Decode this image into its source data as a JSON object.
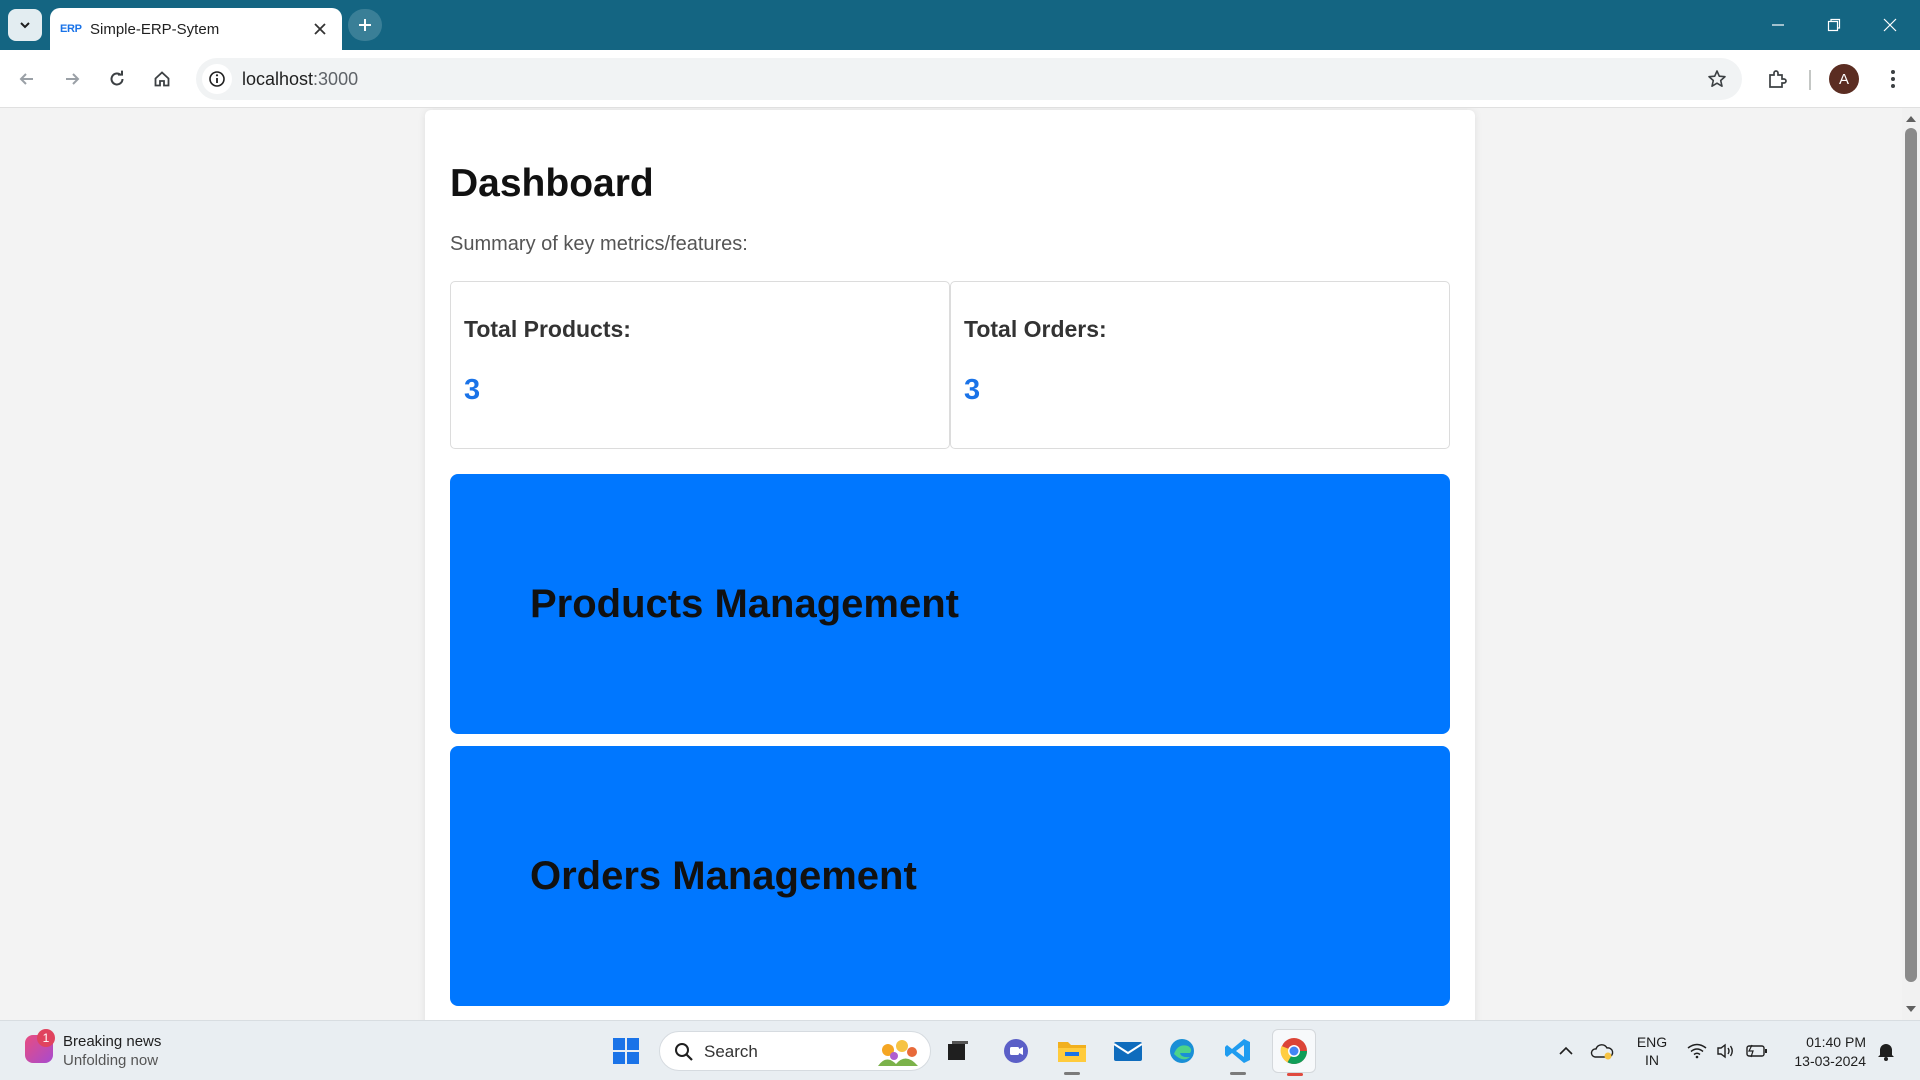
{
  "browser": {
    "tab_title": "Simple-ERP-Sytem",
    "tab_favicon_text": "ERP",
    "url_host": "localhost",
    "url_port": ":3000"
  },
  "page": {
    "title": "Dashboard",
    "subtitle": "Summary of key metrics/features:",
    "metrics": [
      {
        "label": "Total Products:",
        "value": "3"
      },
      {
        "label": "Total Orders:",
        "value": "3"
      }
    ],
    "features": [
      {
        "label": "Products Management"
      },
      {
        "label": "Orders Management"
      }
    ],
    "accent_color": "#0077ff",
    "metric_value_color": "#1a73e8"
  },
  "profile": {
    "initial": "A"
  },
  "taskbar": {
    "news_badge": "1",
    "news_title": "Breaking news",
    "news_subtitle": "Unfolding now",
    "search_label": "Search",
    "lang_line1": "ENG",
    "lang_line2": "IN",
    "time": "01:40 PM",
    "date": "13-03-2024"
  }
}
